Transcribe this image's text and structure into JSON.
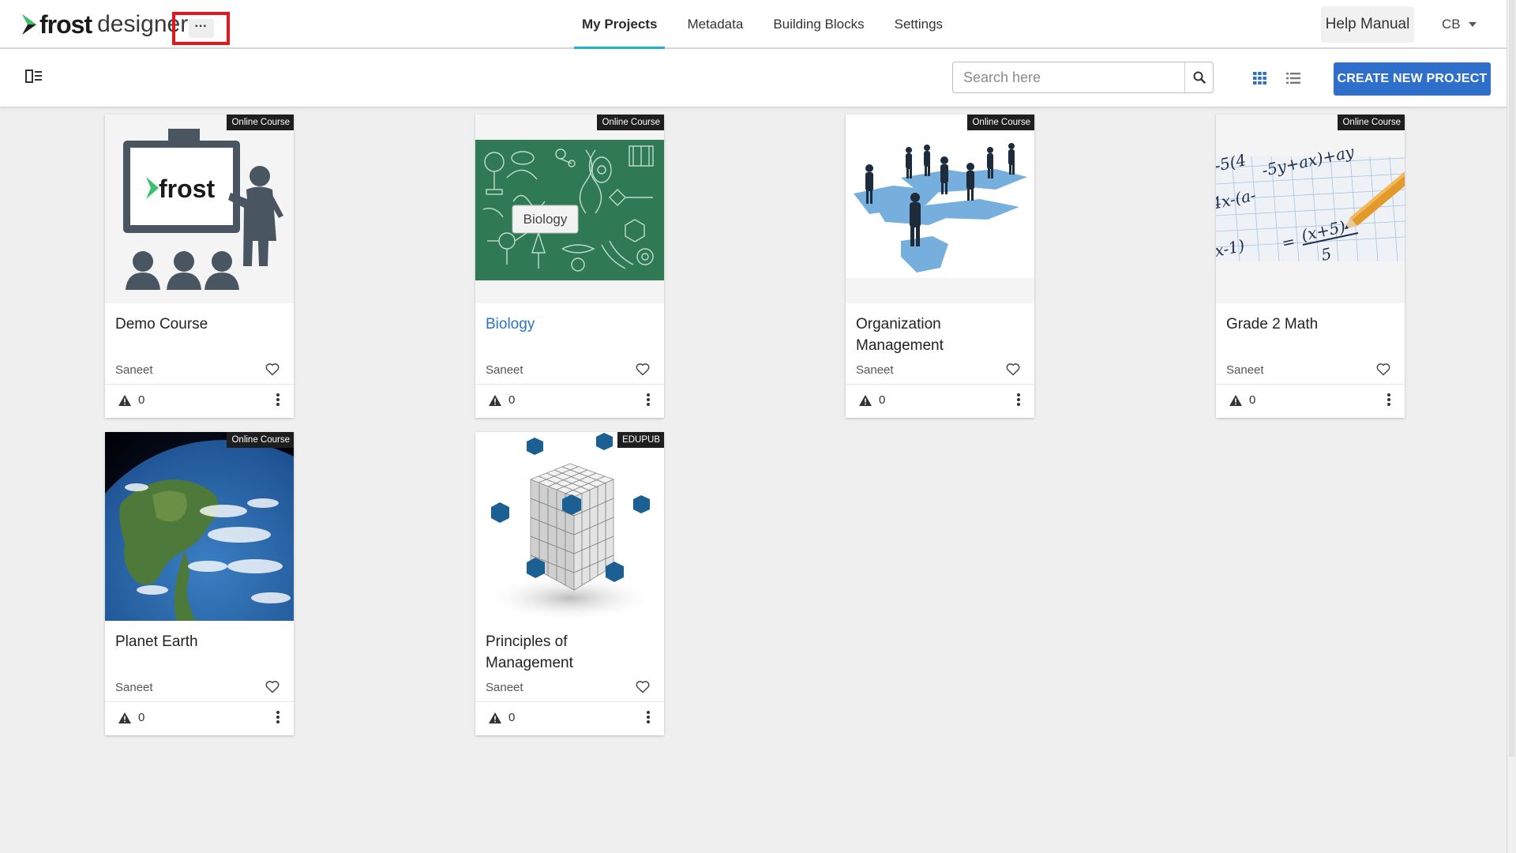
{
  "brand": {
    "frost": "frost",
    "designer": "designer"
  },
  "header": {
    "more_label": "···",
    "nav": [
      {
        "label": "My Projects",
        "active": true
      },
      {
        "label": "Metadata",
        "active": false
      },
      {
        "label": "Building Blocks",
        "active": false
      },
      {
        "label": "Settings",
        "active": false
      }
    ],
    "help_label": "Help Manual",
    "user_initials": "CB"
  },
  "toolbar": {
    "search_placeholder": "Search here",
    "create_label": "CREATE NEW PROJECT"
  },
  "colors": {
    "accent": "#2e6fcb",
    "nav_underline": "#20b1d1",
    "logo_green": "#3ac16b",
    "link": "#2d73c8"
  },
  "projects": [
    {
      "title": "Demo Course",
      "badge": "Online Course",
      "author": "Saneet",
      "warnings": "0",
      "image": "frost-classroom-illustration",
      "highlighted": false
    },
    {
      "title": "Biology",
      "badge": "Online Course",
      "author": "Saneet",
      "warnings": "0",
      "image": "biology-chalkboard",
      "thumb_label": "Biology",
      "highlighted": true
    },
    {
      "title": "Organization Management",
      "badge": "Online Course",
      "author": "Saneet",
      "warnings": "0",
      "image": "business-people-puzzle",
      "highlighted": false
    },
    {
      "title": "Grade 2 Math",
      "badge": "Online Course",
      "author": "Saneet",
      "warnings": "0",
      "image": "math-equation-paper",
      "highlighted": false
    },
    {
      "title": "Planet Earth",
      "badge": "Online Course",
      "author": "Saneet",
      "warnings": "0",
      "image": "earth-globe",
      "highlighted": false
    },
    {
      "title": "Principles of Management",
      "badge": "EDUPUB",
      "author": "Saneet",
      "warnings": "0",
      "image": "cube-blocks",
      "highlighted": false
    }
  ]
}
